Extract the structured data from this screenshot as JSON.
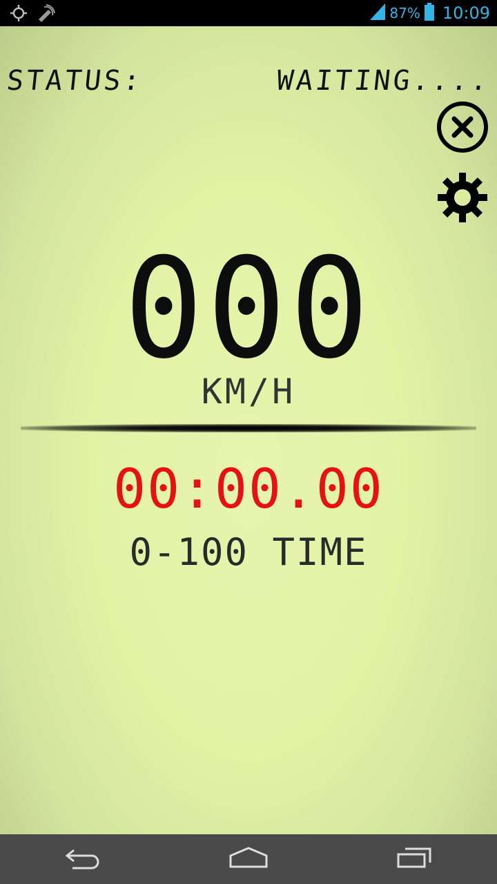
{
  "statusbar": {
    "battery_percent": "87%",
    "time": "10:09",
    "icons": [
      "gps-icon",
      "satellite-icon",
      "signal-icon",
      "battery-icon"
    ]
  },
  "app": {
    "status_label": "STATUS:",
    "status_value": "WAITING....",
    "speed_value": "000",
    "speed_unit": "KM/H",
    "timer_value": "00:00.00",
    "timer_label": "0-100 TIME",
    "timer_color": "#e41212",
    "lcd_color": "#e2f2a5"
  },
  "navbar": {
    "icons": [
      "back-icon",
      "home-icon",
      "recents-icon"
    ]
  }
}
